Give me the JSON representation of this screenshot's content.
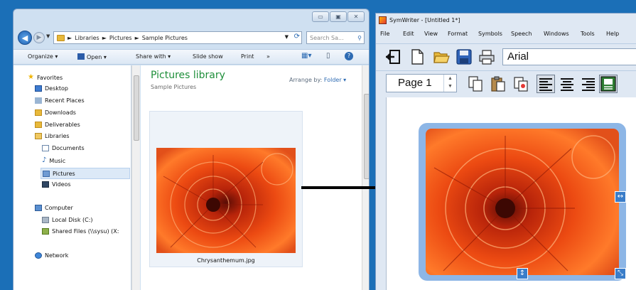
{
  "explorer": {
    "address": {
      "segments": [
        "Libraries",
        "Pictures",
        "Sample Pictures"
      ],
      "separator": "►"
    },
    "search": {
      "placeholder": "Search Sa..."
    },
    "toolbar": {
      "organize": "Organize ▾",
      "open": "Open ▾",
      "share_with": "Share with ▾",
      "slide_show": "Slide show",
      "print": "Print",
      "more": "»"
    },
    "nav": {
      "favorites": "Favorites",
      "desktop": "Desktop",
      "recent_places": "Recent Places",
      "downloads": "Downloads",
      "deliverables": "Deliverables",
      "libraries": "Libraries",
      "documents": "Documents",
      "music": "Music",
      "pictures": "Pictures",
      "videos": "Videos",
      "computer": "Computer",
      "local_disk": "Local Disk (C:)",
      "shared_files": "Shared Files (\\\\sysu) (X:",
      "network": "Network"
    },
    "content": {
      "library_title": "Pictures library",
      "library_subtitle": "Sample Pictures",
      "arrange_label": "Arrange by:",
      "arrange_value": "Folder ▾",
      "thumbnail_name": "Chrysanthemum.jpg"
    }
  },
  "symwriter": {
    "title": "SymWriter - [Untitled 1*]",
    "menu": [
      "File",
      "Edit",
      "View",
      "Format",
      "Symbols",
      "Speech",
      "Windows",
      "Tools",
      "Help"
    ],
    "font_name": "Arial",
    "page_label": "Page 1"
  },
  "colors": {
    "desktop_bg": "#1b6fb7",
    "library_title": "#1e8f3a",
    "selection_frame": "#8db6e6",
    "handle": "#3a7dc9"
  }
}
